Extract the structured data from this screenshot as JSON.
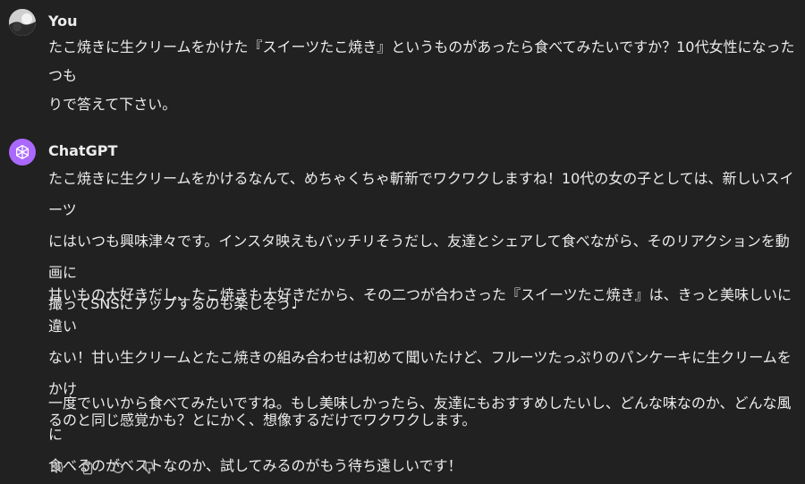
{
  "user_message": {
    "author": "You",
    "text": "たこ焼きに生クリームをかけた『スイーツたこ焼き』というものがあったら食べてみたいですか？10代女性になったつも\nりで答えて下さい。"
  },
  "assistant_message": {
    "author": "ChatGPT",
    "paragraphs": [
      "たこ焼きに生クリームをかけるなんて、めちゃくちゃ斬新でワクワクしますね！10代の女の子としては、新しいスイーツ\nにはいつも興味津々です。インスタ映えもバッチリそうだし、友達とシェアして食べながら、そのリアクションを動画に\n撮ってSNSにアップするのも楽しそう♪",
      "甘いもの大好きだし、たこ焼きも大好きだから、その二つが合わさった『スイーツたこ焼き』は、きっと美味しいに違い\nない！甘い生クリームとたこ焼きの組み合わせは初めて聞いたけど、フルーツたっぷりのパンケーキに生クリームをかけ\nるのと同じ感覚かも？とにかく、想像するだけでワクワクします。",
      "一度でいいから食べてみたいですね。もし美味しかったら、友達にもおすすめしたいし、どんな味なのか、どんな風に\n食べるのがベストなのか、試してみるのがもう待ち遠しいです！"
    ]
  },
  "actions": {
    "read_aloud_icon": "speaker-icon",
    "copy_icon": "clipboard-icon",
    "regenerate_icon": "regenerate-icon",
    "dislike_icon": "thumbs-down-icon"
  },
  "colors": {
    "background": "#212121",
    "text": "#ececec",
    "chatgpt_avatar": "#ab68ff",
    "icon": "#b4b4b4"
  }
}
